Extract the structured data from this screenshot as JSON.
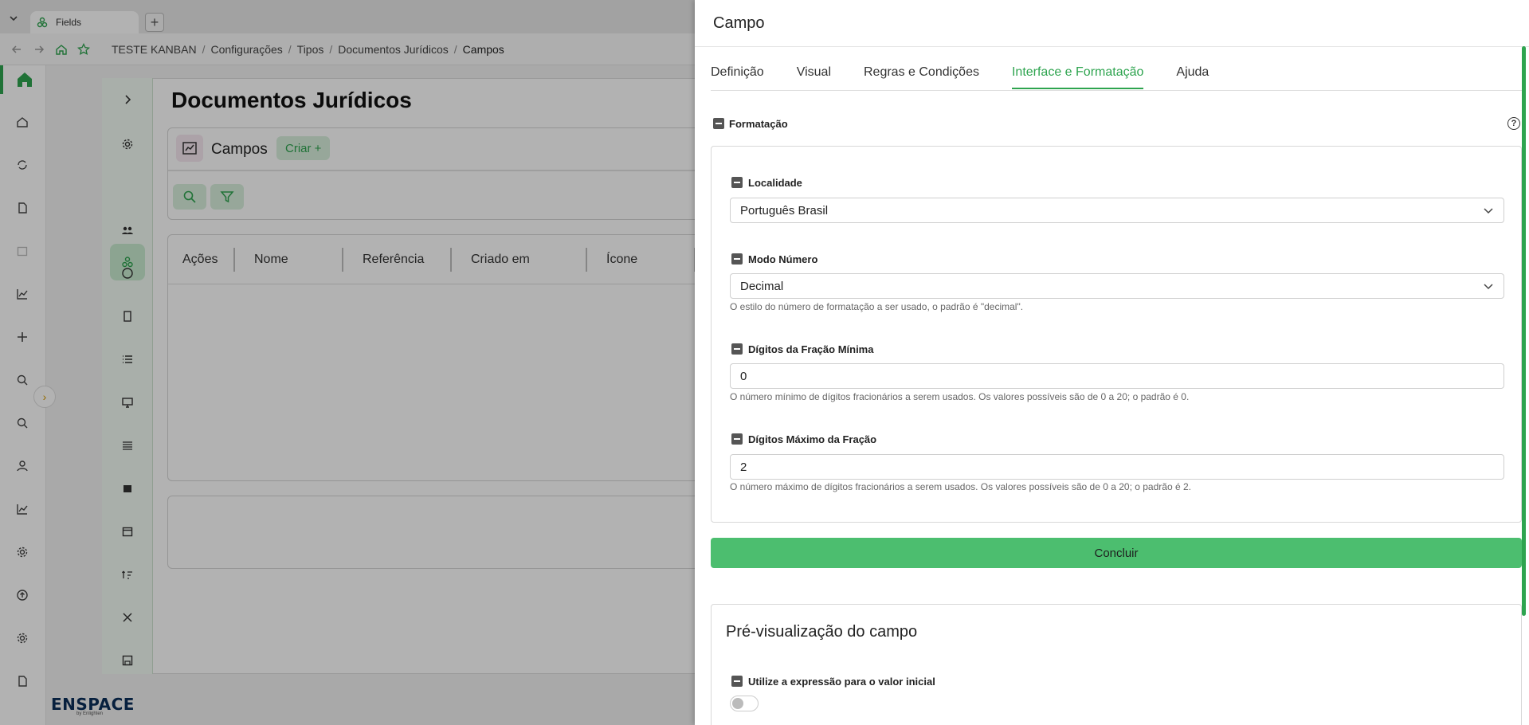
{
  "browser": {
    "tab_title": "Fields",
    "breadcrumbs": [
      "TESTE KANBAN",
      "Configurações",
      "Tipos",
      "Documentos Jurídicos",
      "Campos"
    ]
  },
  "app": {
    "brand": "ENSPACE",
    "brand_sub": "by Enlighten",
    "accent_color": "#2ea44f"
  },
  "page": {
    "title": "Documentos Jurídicos",
    "card_title": "Campos",
    "create_label": "Criar +",
    "table_columns": [
      "Ações",
      "Nome",
      "Referência",
      "Criado em",
      "Ícone"
    ]
  },
  "drawer": {
    "title": "Campo",
    "tabs": [
      "Definição",
      "Visual",
      "Regras e Condições",
      "Interface e Formatação",
      "Ajuda"
    ],
    "active_tab": "Interface e Formatação",
    "section_title": "Formatação",
    "help_icon": "?",
    "fields": {
      "locale": {
        "label": "Localidade",
        "value": "Português Brasil"
      },
      "number_mode": {
        "label": "Modo Número",
        "value": "Decimal",
        "hint": "O estilo do número de formatação a ser usado, o padrão é \"decimal\"."
      },
      "min_fraction": {
        "label": "Dígitos da Fração Mínima",
        "value": "0",
        "hint": "O número mínimo de dígitos fracionários a serem usados. Os valores possíveis são de 0 a 20; o padrão é 0."
      },
      "max_fraction": {
        "label": "Dígitos Máximo da Fração",
        "value": "2",
        "hint": "O número máximo de dígitos fracionários a serem usados. Os valores possíveis são de 0 a 20; o padrão é 2."
      }
    },
    "submit_label": "Concluir",
    "preview": {
      "title": "Pré-visualização do campo",
      "initial_expr_label": "Utilize a expressão para o valor inicial",
      "initial_expr_enabled": false
    }
  }
}
